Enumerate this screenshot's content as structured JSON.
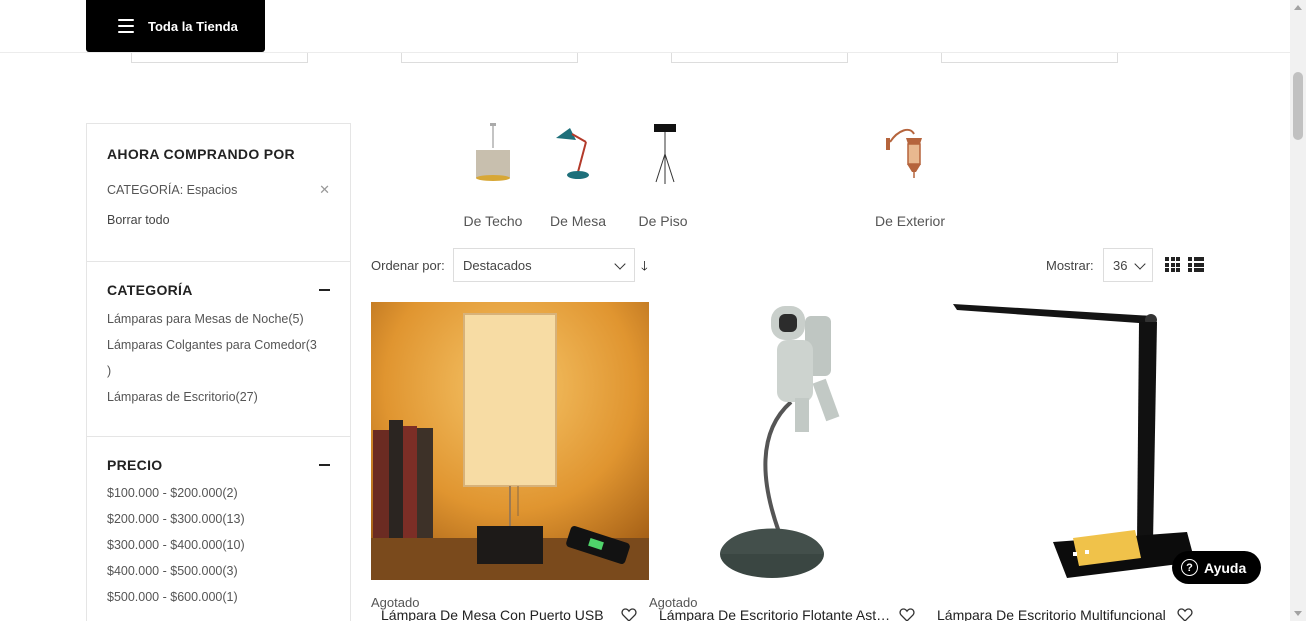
{
  "header": {
    "store_button": "Toda la Tienda"
  },
  "sidebar": {
    "shopping_by": {
      "title": "AHORA COMPRANDO POR",
      "filter_label": "CATEGORÍA: Espacios",
      "clear_all": "Borrar todo"
    },
    "category": {
      "title": "CATEGORÍA",
      "items": [
        "Lámparas para Mesas de Noche(5)",
        "Lámparas Colgantes para Comedor(3",
        ")",
        "Lámparas de Escritorio(27)"
      ]
    },
    "price": {
      "title": "PRECIO",
      "items": [
        "$100.000 - $200.000(2)",
        "$200.000 - $300.000(13)",
        "$300.000 - $400.000(10)",
        "$400.000 - $500.000(3)",
        "$500.000 - $600.000(1)"
      ]
    }
  },
  "categories": [
    {
      "name": "De Techo",
      "icon": "pendant-lamp-icon"
    },
    {
      "name": "De Mesa",
      "icon": "desk-lamp-icon"
    },
    {
      "name": "De Piso",
      "icon": "floor-lamp-icon"
    },
    {
      "name": "De Exterior",
      "icon": "wall-lantern-icon"
    }
  ],
  "toolbar": {
    "sort_label": "Ordenar por:",
    "sort_value": "Destacados",
    "sort_direction_icon": "arrow-down-icon",
    "show_label": "Mostrar:",
    "show_value": "36"
  },
  "products": [
    {
      "stock": "Agotado",
      "title": "Lámpara De Mesa Con Puerto USB",
      "image": "table-lamp-photo"
    },
    {
      "stock": "Agotado",
      "title": "Lámpara De Escritorio Flotante Astronauta",
      "image": "astronaut-lamp-photo"
    },
    {
      "stock": "",
      "title": "Lámpara De Escritorio Multifuncional",
      "image": "led-desk-lamp-photo"
    }
  ],
  "help": {
    "label": "Ayuda"
  },
  "colors": {
    "accent": "#000000",
    "border": "#e5e5e5",
    "text": "#333333"
  }
}
